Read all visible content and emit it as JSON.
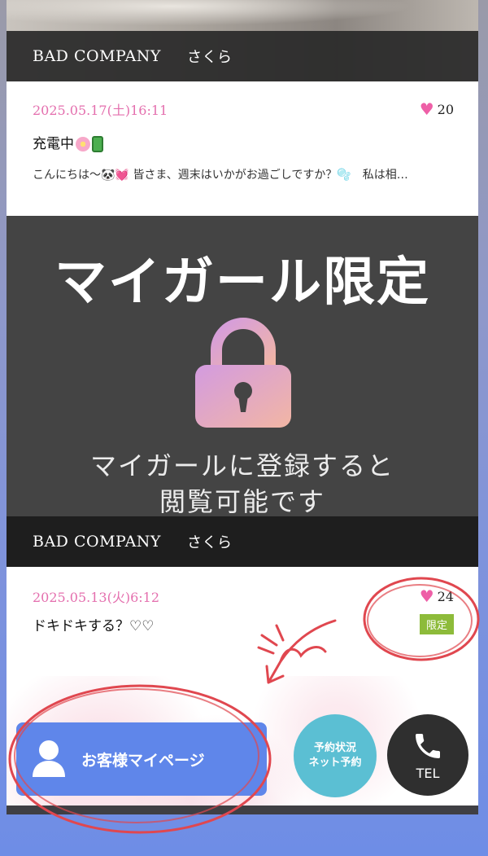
{
  "posts": [
    {
      "shop": "BAD COMPANY",
      "girl": "さくら",
      "date": "2025.05.17(土)16:11",
      "likes": "20",
      "title": "充電中",
      "excerpt": "こんにちは〜🐼💓 皆さま、週末はいかがお過ごしですか？🫧　私は相…"
    },
    {
      "shop": "BAD COMPANY",
      "girl": "さくら",
      "date": "2025.05.13(火)6:12",
      "likes": "24",
      "title": "ドキドキする？♡♡",
      "badge": "限定"
    }
  ],
  "locked": {
    "title": "マイガール限定",
    "message_line1": "マイガールに登録すると",
    "message_line2": "閲覧可能です",
    "icon": "lock-icon"
  },
  "footer": {
    "mypage_label": "お客様マイページ",
    "reserve_line1": "予約状況",
    "reserve_line2": "ネット予約",
    "tel_label": "TEL"
  },
  "colors": {
    "date_pink": "#e46fae",
    "heart_pink": "#ee5fa7",
    "mypage_blue": "#5f86ea",
    "reserve_teal": "#5bbfd3",
    "badge_green": "#8dbb3a",
    "annotation_red": "#e0474f"
  }
}
